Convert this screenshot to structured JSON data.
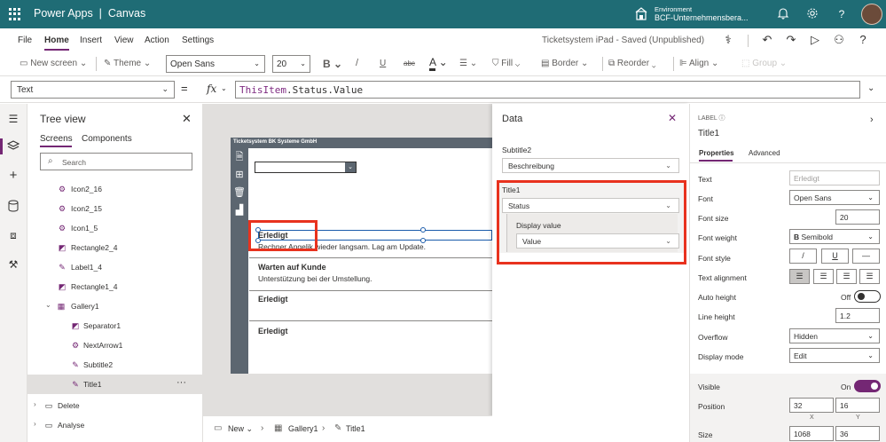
{
  "app": {
    "title": "Power Apps",
    "subtitle": "Canvas"
  },
  "environment": {
    "label": "Environment",
    "value": "BCF-Unternehmensbera..."
  },
  "menu": {
    "items": [
      "File",
      "Home",
      "Insert",
      "View",
      "Action",
      "Settings"
    ],
    "active": "Home",
    "status": "Ticketsystem iPad - Saved (Unpublished)"
  },
  "toolbar": {
    "new_screen": "New screen",
    "theme": "Theme",
    "font": "Open Sans",
    "font_size": "20",
    "bold": "B",
    "italic": "/",
    "underline": "U",
    "strike": "abc",
    "font_color": "A",
    "fill": "Fill",
    "border": "Border",
    "reorder": "Reorder",
    "align": "Align",
    "group": "Group"
  },
  "formula": {
    "property": "Text",
    "eq": "=",
    "fx": "fx",
    "object": "ThisItem",
    "rest": ".Status.Value"
  },
  "tree": {
    "title": "Tree view",
    "tabs": [
      "Screens",
      "Components"
    ],
    "search_placeholder": "Search",
    "items": [
      "Icon2_16",
      "Icon2_15",
      "Icon1_5",
      "Rectangle2_4",
      "Label1_4",
      "Rectangle1_4",
      "Gallery1",
      "Separator1",
      "NextArrow1",
      "Subtitle2",
      "Title1",
      "Delete",
      "Analyse"
    ]
  },
  "screen": {
    "header": "Ticketsystem BK Systeme GmbH",
    "items": [
      {
        "title": "Erledigt",
        "subtitle": "Rechner Angelik  wieder langsam. Lag am Update."
      },
      {
        "title": "Warten auf Kunde",
        "subtitle": "Unterstützung bei der Umstellung."
      },
      {
        "title": "Erledigt",
        "subtitle": ""
      },
      {
        "title": "Erledigt",
        "subtitle": ""
      }
    ]
  },
  "data_panel": {
    "title": "Data",
    "subtitle2_label": "Subtitle2",
    "subtitle2_value": "Beschreibung",
    "title1_label": "Title1",
    "title1_value": "Status",
    "display_label": "Display value",
    "display_value": "Value"
  },
  "props": {
    "type": "LABEL",
    "control": "Title1",
    "tabs": [
      "Properties",
      "Advanced"
    ],
    "rows": {
      "text": {
        "label": "Text",
        "value": "Erledigt"
      },
      "font": {
        "label": "Font",
        "value": "Open Sans"
      },
      "font_size": {
        "label": "Font size",
        "value": "20"
      },
      "font_weight": {
        "label": "Font weight",
        "value": "Semibold",
        "icon": "B"
      },
      "font_style": {
        "label": "Font style"
      },
      "text_alignment": {
        "label": "Text alignment"
      },
      "auto_height": {
        "label": "Auto height",
        "value": "Off"
      },
      "line_height": {
        "label": "Line height",
        "value": "1.2"
      },
      "overflow": {
        "label": "Overflow",
        "value": "Hidden"
      },
      "display_mode": {
        "label": "Display mode",
        "value": "Edit"
      },
      "visible": {
        "label": "Visible",
        "value": "On"
      },
      "position": {
        "label": "Position",
        "x": "32",
        "y": "16",
        "x_label": "X",
        "y_label": "Y"
      },
      "size": {
        "label": "Size",
        "width": "1068",
        "height": "36"
      }
    }
  },
  "bottom": {
    "new": "New",
    "gallery": "Gallery1",
    "title": "Title1"
  },
  "colors": {
    "topbar": "#1f6c75",
    "accent": "#742774",
    "highlight": "#e8321e",
    "selection": "#1b5cab"
  }
}
